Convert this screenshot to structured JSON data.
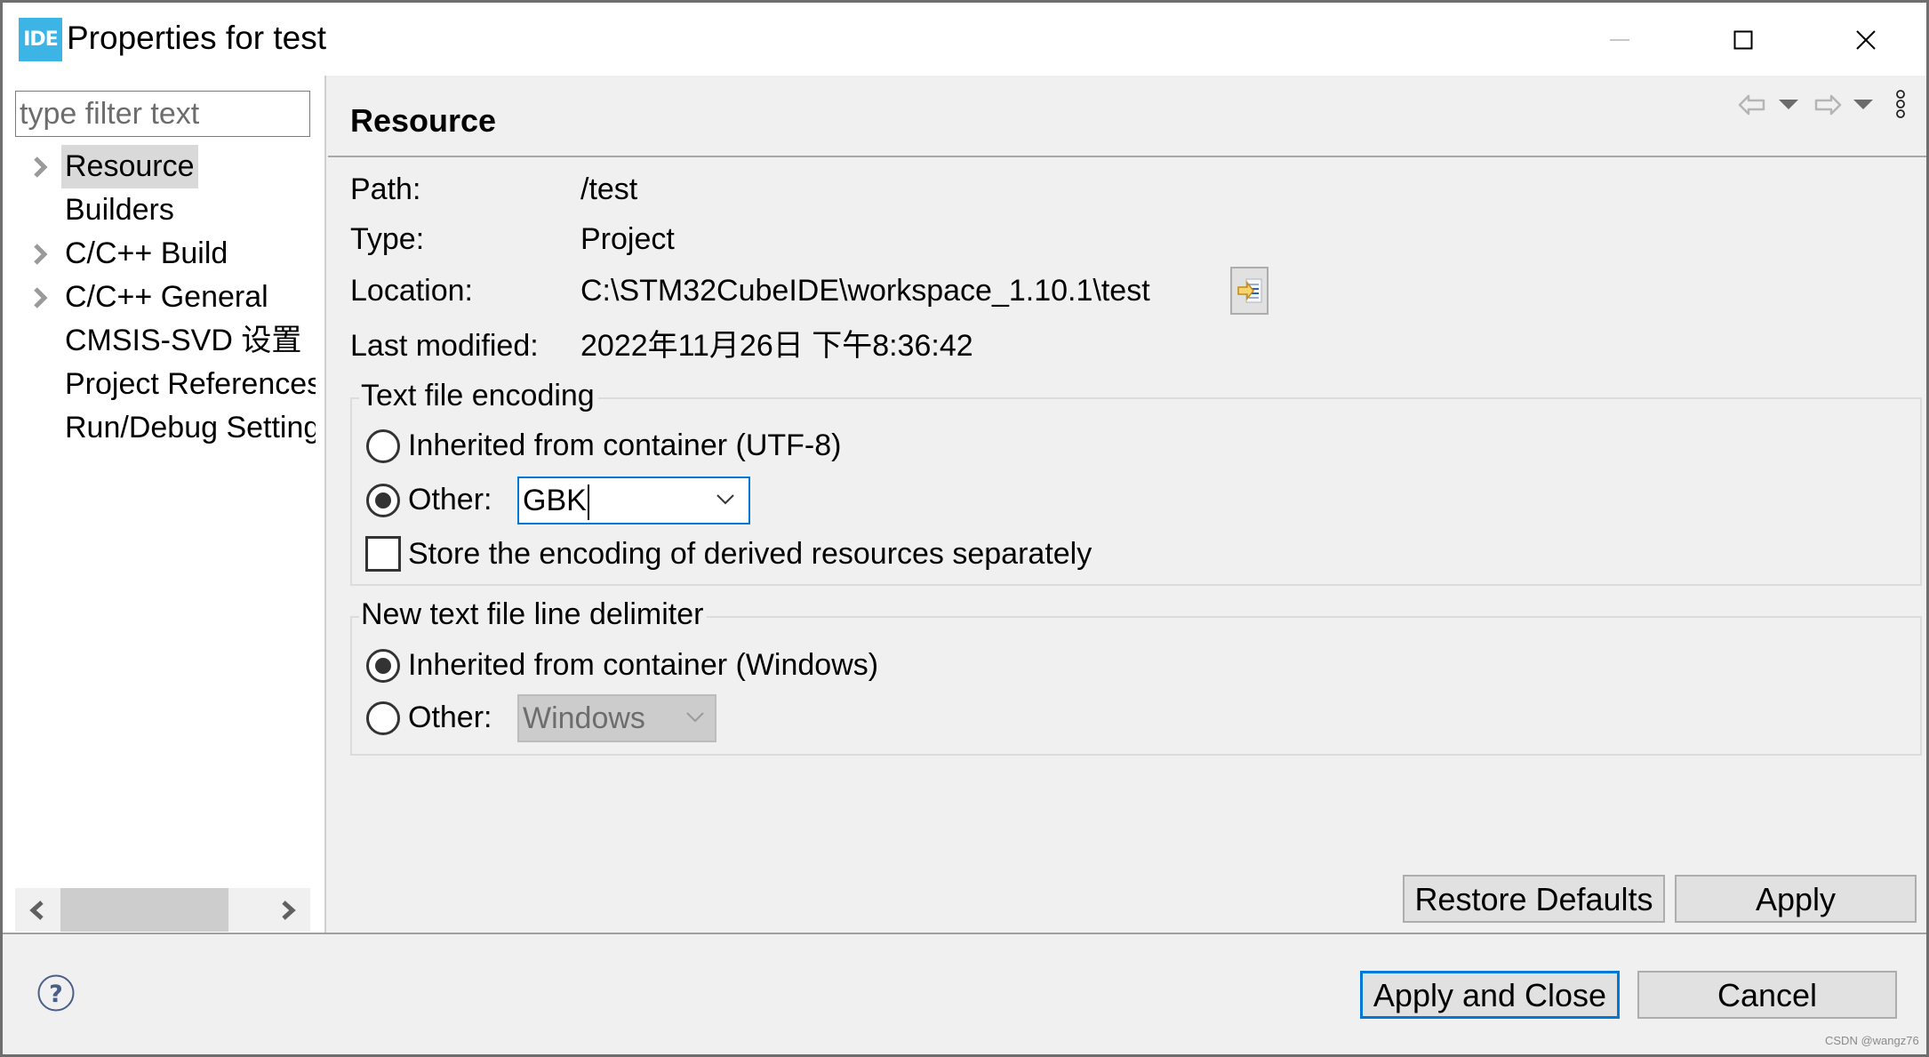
{
  "window": {
    "app_icon_text": "IDE",
    "title": "Properties for test",
    "controls": {
      "minimize": "minimize-icon",
      "maximize": "maximize-icon",
      "close": "close-icon"
    }
  },
  "sidebar": {
    "filter_placeholder": "type filter text",
    "filter_value": "",
    "items": [
      {
        "label": "Resource",
        "expandable": true,
        "selected": true
      },
      {
        "label": "Builders",
        "expandable": false,
        "selected": false
      },
      {
        "label": "C/C++ Build",
        "expandable": true,
        "selected": false
      },
      {
        "label": "C/C++ General",
        "expandable": true,
        "selected": false
      },
      {
        "label": "CMSIS-SVD 设置",
        "expandable": false,
        "selected": false
      },
      {
        "label": "Project References",
        "expandable": false,
        "selected": false
      },
      {
        "label": "Run/Debug Settings",
        "expandable": false,
        "selected": false
      }
    ]
  },
  "page": {
    "title": "Resource",
    "nav": {
      "back": "back-arrow-icon",
      "back_menu": "dropdown-icon",
      "forward": "forward-arrow-icon",
      "forward_menu": "dropdown-icon",
      "more": "kebab-menu-icon"
    },
    "properties": [
      {
        "label": "Path:",
        "value": "/test"
      },
      {
        "label": "Type:",
        "value": "Project"
      },
      {
        "label": "Location:",
        "value": "C:\\STM32CubeIDE\\workspace_1.10.1\\test"
      },
      {
        "label": "Last modified:",
        "value": "2022年11月26日 下午8:36:42"
      }
    ],
    "encoding": {
      "title": "Text file encoding",
      "inherited_label": "Inherited from container (UTF-8)",
      "inherited_selected": false,
      "other_label": "Other:",
      "other_selected": true,
      "other_value": "GBK",
      "store_separately_label": "Store the encoding of derived resources separately",
      "store_separately_checked": false
    },
    "delimiter": {
      "title": "New text file line delimiter",
      "inherited_label": "Inherited from container (Windows)",
      "inherited_selected": true,
      "other_label": "Other:",
      "other_selected": false,
      "other_value": "Windows",
      "other_enabled": false
    },
    "restore_defaults": "Restore Defaults",
    "apply": "Apply"
  },
  "footer": {
    "help": "help-icon",
    "apply_and_close": "Apply and Close",
    "cancel": "Cancel"
  },
  "watermark": "CSDN @wangz76"
}
